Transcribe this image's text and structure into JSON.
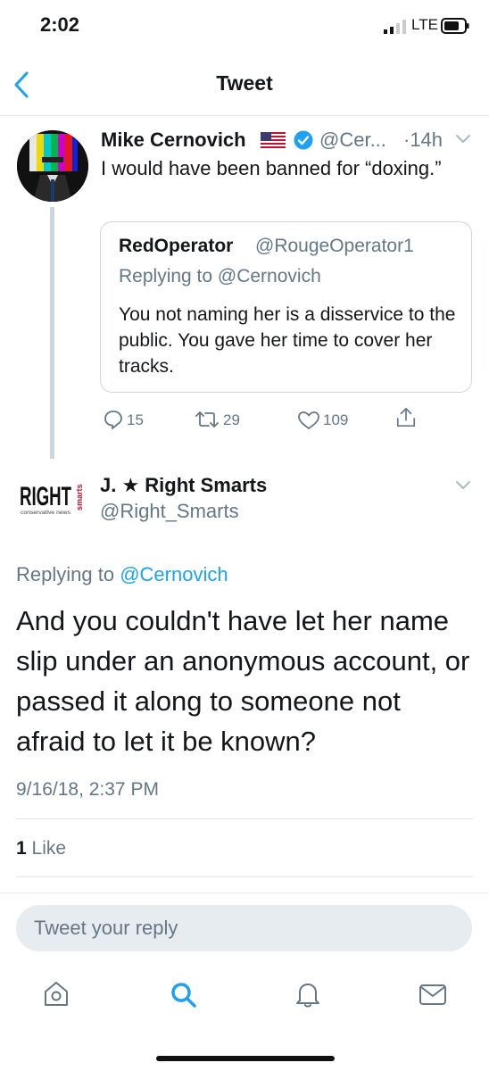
{
  "status_bar": {
    "time": "2:02",
    "network": "LTE"
  },
  "nav": {
    "title": "Tweet"
  },
  "parent_tweet": {
    "name": "Mike Cernovich",
    "handle": "@Cer...",
    "time": "·14h",
    "text": "I would have been banned for “doxing.”",
    "quoted": {
      "name": "RedOperator",
      "handle": "@RougeOperator1",
      "replying_to": "Replying to @Cernovich",
      "text": "You not naming her is a disservice to the public. You gave her time to cover her tracks."
    },
    "actions": {
      "replies": "15",
      "retweets": "29",
      "likes": "109"
    }
  },
  "reply_tweet": {
    "logo_text": "RIGHT",
    "logo_sub": "conservative news",
    "logo_side": "smarts",
    "name": "J. ★ Right Smarts",
    "handle": "@Right_Smarts",
    "replying_prefix": "Replying to",
    "replying_handle": "@Cernovich",
    "text": "And you couldn't have let her name slip under an anonymous account, or passed it along to someone not afraid to let it be known?",
    "timestamp": "9/16/18, 2:37 PM",
    "like_count": "1",
    "like_label": "Like"
  },
  "composer": {
    "placeholder": "Tweet your reply"
  },
  "tabbar": {
    "icons": [
      "home-icon",
      "search-icon",
      "notifications-icon",
      "messages-icon"
    ],
    "active": "search-icon"
  },
  "colors": {
    "accent": "#1da1f2",
    "secondary_text": "#657786",
    "divider": "#e1e8ed"
  }
}
